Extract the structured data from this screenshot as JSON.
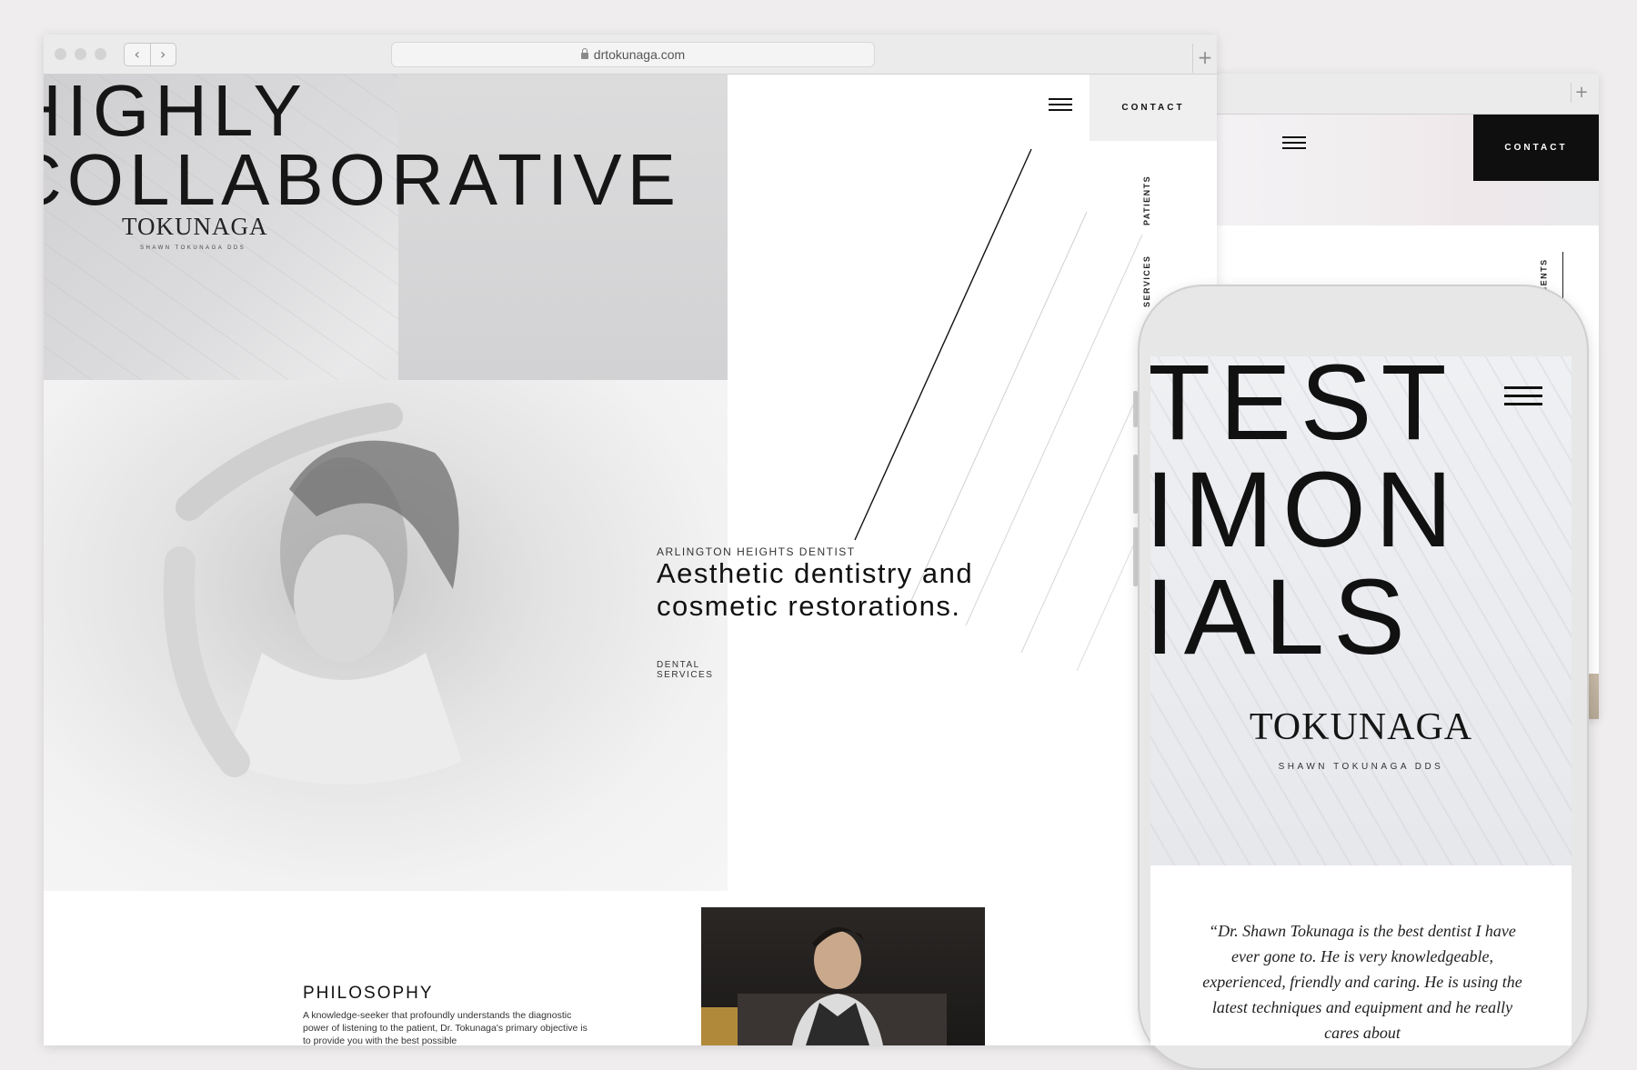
{
  "back_window": {
    "contact_label": "CONTACT",
    "side_nav_label": "PATIENTS"
  },
  "browser": {
    "url": "drtokunaga.com",
    "new_tab": "+",
    "back": "‹",
    "forward": "›"
  },
  "hero": {
    "title_line1": "HIGHLY",
    "title_line2": "COLLABORATIVE",
    "logo": "TOKUNAGA",
    "logo_sub": "SHAWN TOKUNAGA DDS"
  },
  "header": {
    "contact_label": "CONTACT",
    "side_nav": [
      "PATIENTS",
      "SERVICES"
    ]
  },
  "intro": {
    "kicker": "ARLINGTON HEIGHTS DENTIST",
    "headline": "Aesthetic dentistry and cosmetic restorations.",
    "link": "DENTAL SERVICES"
  },
  "philosophy": {
    "title": "PHILOSOPHY",
    "body": "A knowledge-seeker that profoundly understands the diagnostic power of listening to the patient, Dr. Tokunaga's primary objective is to provide you with the best possible"
  },
  "phone": {
    "title_lines": [
      "TEST",
      "IMON",
      "IALS"
    ],
    "logo": "TOKUNAGA",
    "logo_sub": "SHAWN TOKUNAGA DDS",
    "quote": "“Dr. Shawn Tokunaga is the best dentist I have ever gone to. He is very knowledgeable, experienced, friendly and caring. He is using the latest techniques and equipment and he really cares about"
  },
  "colors": {
    "background": "#efedee",
    "black_button": "#0f0f0f",
    "grey_button": "#efefef",
    "text": "#111111"
  }
}
